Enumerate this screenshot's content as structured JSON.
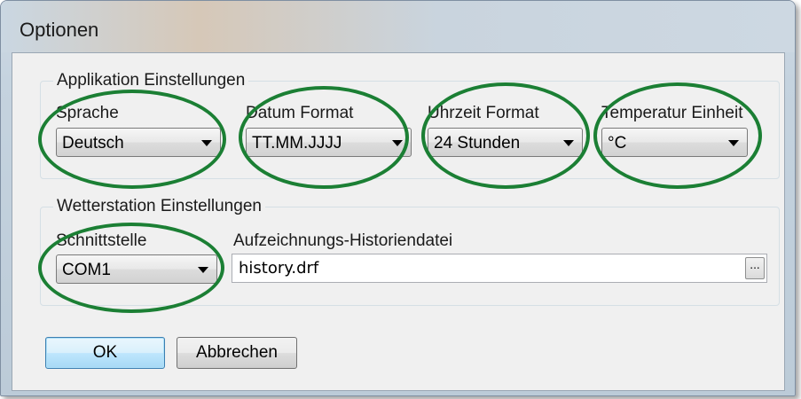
{
  "window": {
    "title": "Optionen"
  },
  "app_settings": {
    "group_title": "Applikation Einstellungen",
    "language": {
      "label": "Sprache",
      "value": "Deutsch"
    },
    "date_format": {
      "label": "Datum Format",
      "value": "TT.MM.JJJJ"
    },
    "time_format": {
      "label": "Uhrzeit Format",
      "value": "24 Stunden"
    },
    "temperature_unit": {
      "label": "Temperatur Einheit",
      "value": "°C"
    }
  },
  "station_settings": {
    "group_title": "Wetterstation Einstellungen",
    "interface": {
      "label": "Schnittstelle",
      "value": "COM1"
    },
    "history_file": {
      "label": "Aufzeichnungs-Historiendatei",
      "value": "history.drf",
      "browse_label": "..."
    }
  },
  "buttons": {
    "ok": "OK",
    "cancel": "Abbrechen"
  },
  "annotation": {
    "highlight_color": "#1b7f34"
  }
}
